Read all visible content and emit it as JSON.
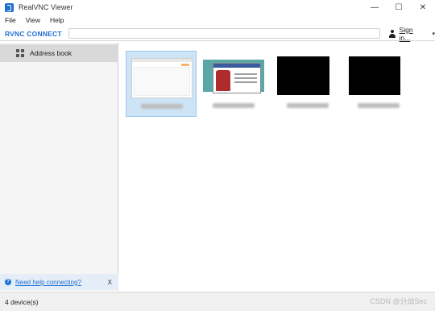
{
  "window": {
    "title": "RealVNC Viewer",
    "controls": {
      "minimize": "—",
      "maximize": "☐",
      "close": "✕"
    }
  },
  "menu": {
    "items": [
      "File",
      "View",
      "Help"
    ]
  },
  "connect_bar": {
    "logo": "RVNC CONNECT",
    "address_value": "",
    "signin_label": "Sign in...",
    "dropdown": "▾"
  },
  "sidebar": {
    "items": [
      {
        "label": "Address book",
        "icon": "grid-icon"
      }
    ],
    "help": {
      "icon": "?",
      "link_text": "Need help connecting?",
      "close": "X"
    }
  },
  "devices": [
    {
      "thumbnail": "white-desktop",
      "selected": true
    },
    {
      "thumbnail": "teal-desktop-dialog",
      "selected": false
    },
    {
      "thumbnail": "black-screen",
      "selected": false
    },
    {
      "thumbnail": "black-screen",
      "selected": false
    }
  ],
  "status": {
    "device_count": "4 device(s)"
  },
  "watermark": "CSDN @分战Sec",
  "colors": {
    "accent": "#1f6fd1",
    "selection": "#cde4f7"
  }
}
